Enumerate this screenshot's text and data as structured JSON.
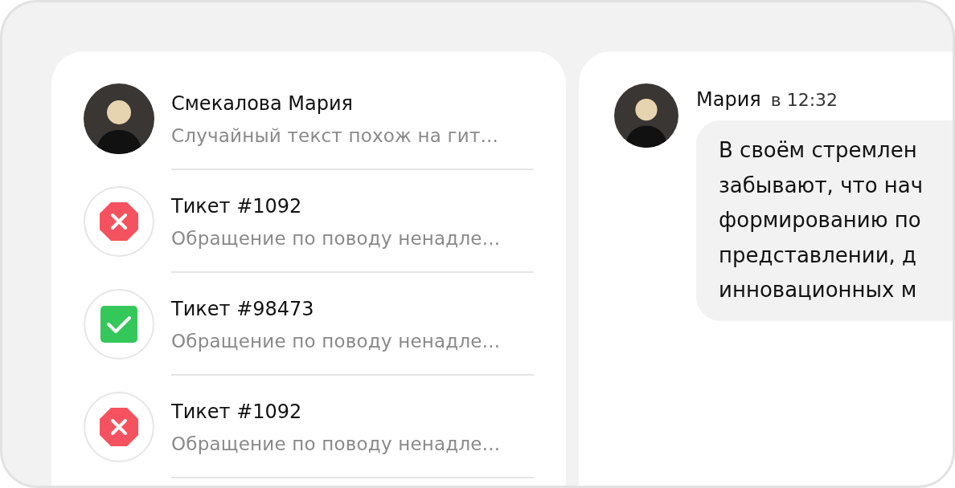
{
  "conversations": [
    {
      "kind": "person",
      "title": "Смекалова Мария",
      "preview": "Случайный текст похож на гит..."
    },
    {
      "kind": "rejected",
      "title": "Тикет #1092",
      "preview": "Обращение по поводу ненадле..."
    },
    {
      "kind": "resolved",
      "title": "Тикет #98473",
      "preview": "Обращение по поводу ненадле..."
    },
    {
      "kind": "rejected",
      "title": "Тикет #1092",
      "preview": "Обращение по поводу ненадле..."
    }
  ],
  "message": {
    "author": "Мария",
    "time": "в 12:32",
    "lines": [
      "В своём стремлен",
      "забывают, что нач",
      "формированию по",
      "представлении, д",
      "инновационных м"
    ]
  }
}
